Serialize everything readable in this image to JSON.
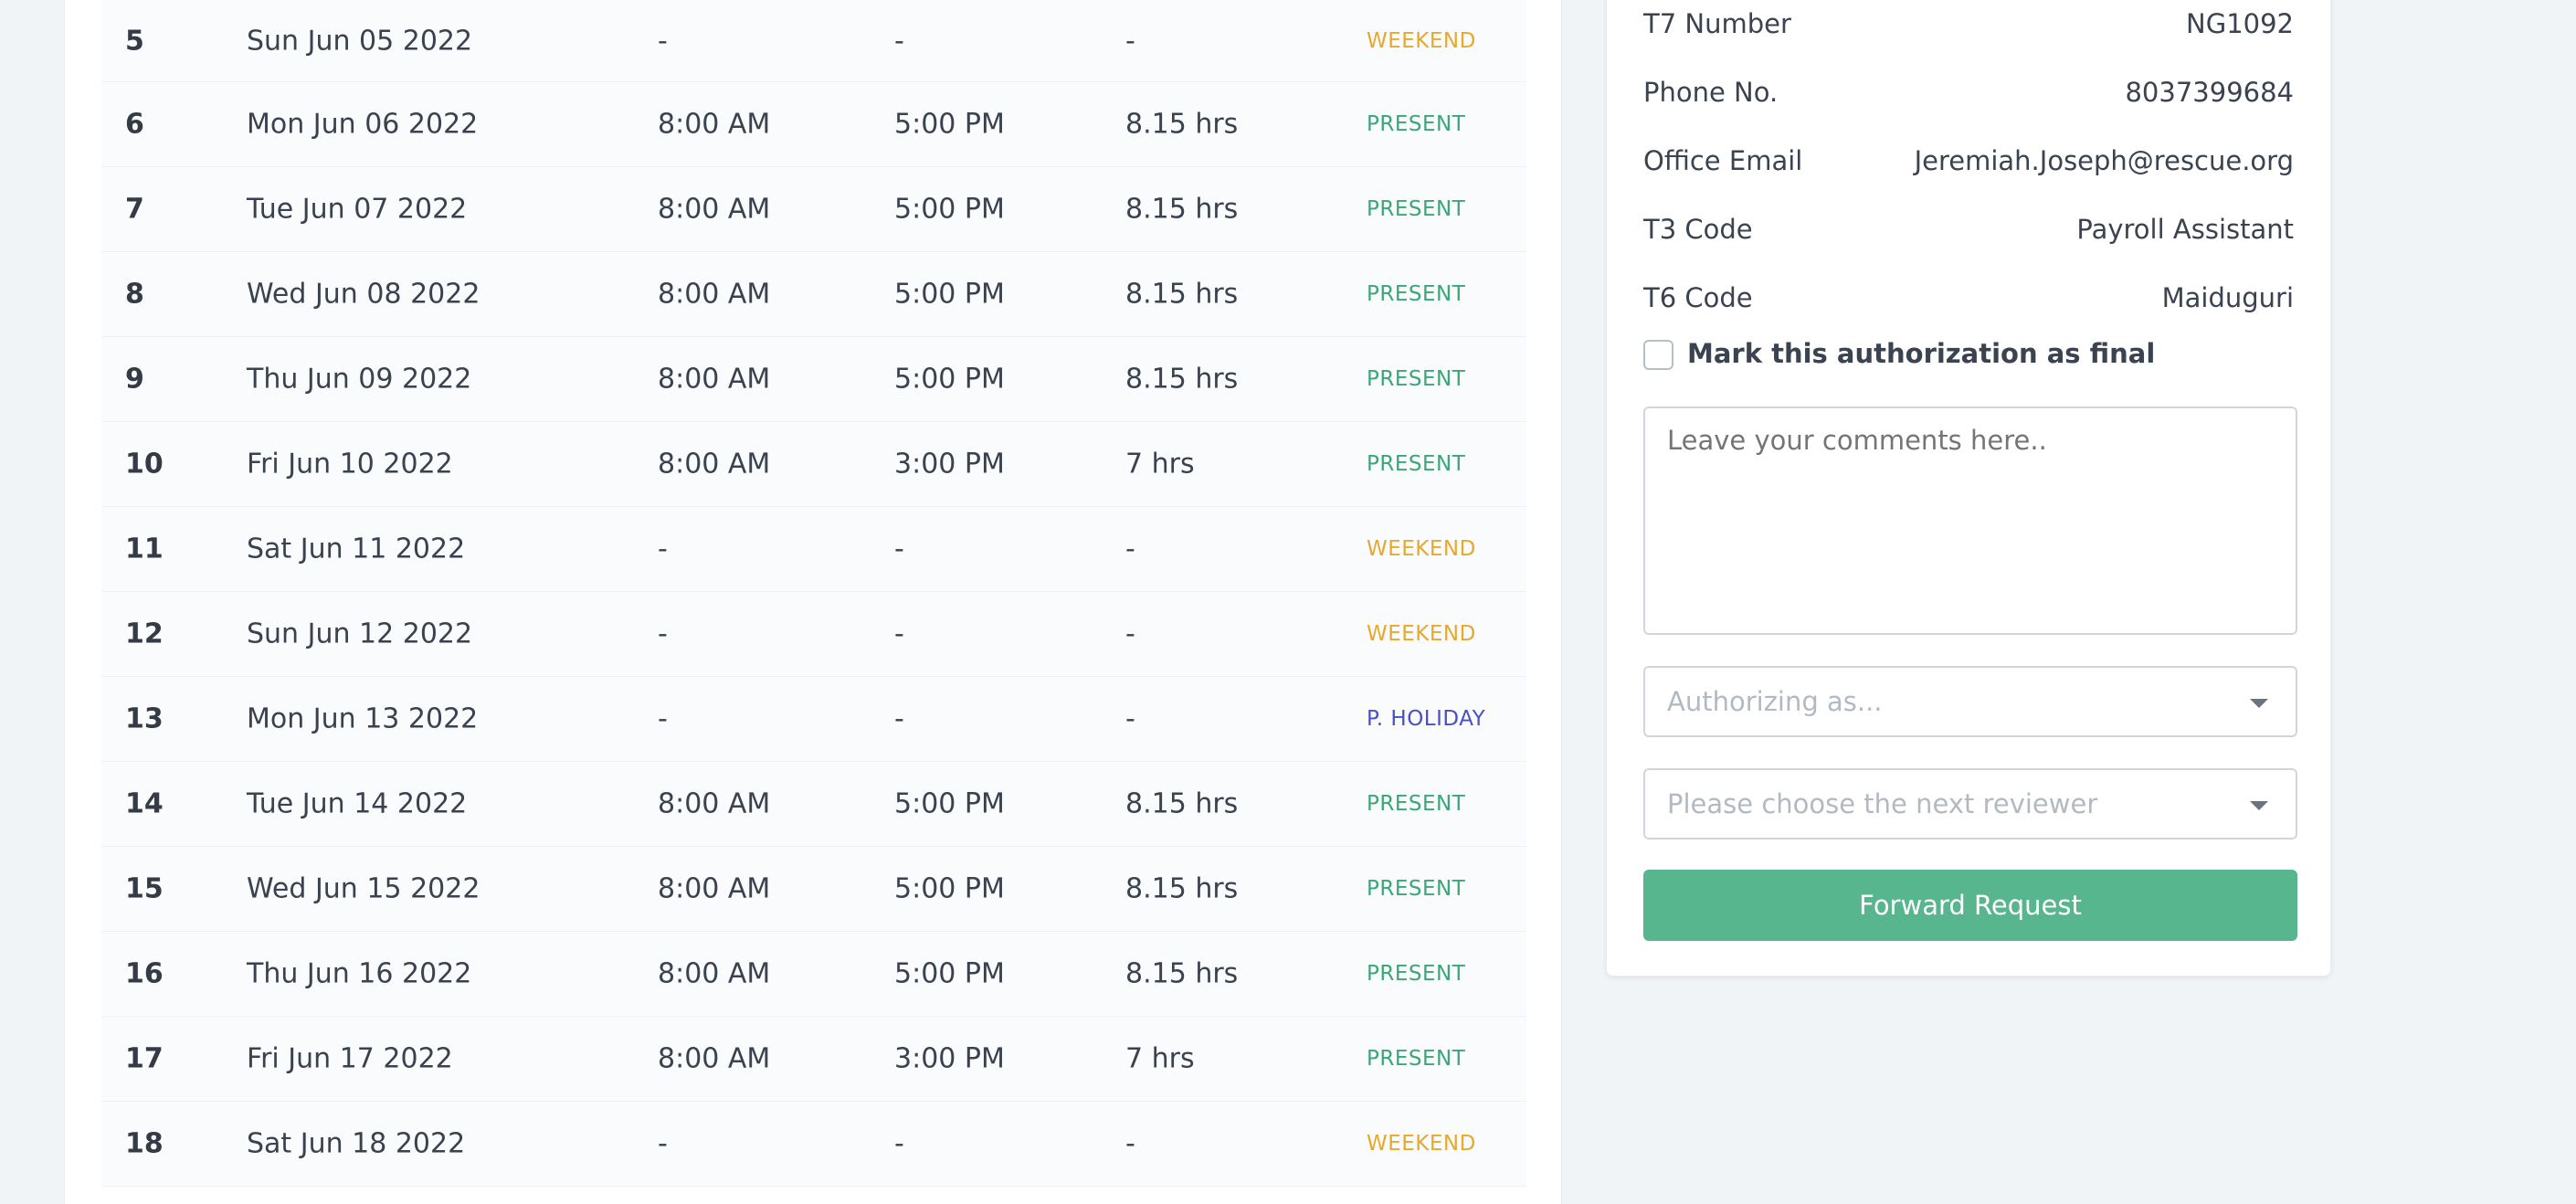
{
  "attendance": {
    "rows": [
      {
        "num": "5",
        "date": "Sun Jun 05 2022",
        "in": "-",
        "out": "-",
        "hours": "-",
        "status": "WEEKEND"
      },
      {
        "num": "6",
        "date": "Mon Jun 06 2022",
        "in": "8:00 AM",
        "out": "5:00 PM",
        "hours": "8.15 hrs",
        "status": "PRESENT"
      },
      {
        "num": "7",
        "date": "Tue Jun 07 2022",
        "in": "8:00 AM",
        "out": "5:00 PM",
        "hours": "8.15 hrs",
        "status": "PRESENT"
      },
      {
        "num": "8",
        "date": "Wed Jun 08 2022",
        "in": "8:00 AM",
        "out": "5:00 PM",
        "hours": "8.15 hrs",
        "status": "PRESENT"
      },
      {
        "num": "9",
        "date": "Thu Jun 09 2022",
        "in": "8:00 AM",
        "out": "5:00 PM",
        "hours": "8.15 hrs",
        "status": "PRESENT"
      },
      {
        "num": "10",
        "date": "Fri Jun 10 2022",
        "in": "8:00 AM",
        "out": "3:00 PM",
        "hours": "7 hrs",
        "status": "PRESENT"
      },
      {
        "num": "11",
        "date": "Sat Jun 11 2022",
        "in": "-",
        "out": "-",
        "hours": "-",
        "status": "WEEKEND"
      },
      {
        "num": "12",
        "date": "Sun Jun 12 2022",
        "in": "-",
        "out": "-",
        "hours": "-",
        "status": "WEEKEND"
      },
      {
        "num": "13",
        "date": "Mon Jun 13 2022",
        "in": "-",
        "out": "-",
        "hours": "-",
        "status": "P. HOLIDAY"
      },
      {
        "num": "14",
        "date": "Tue Jun 14 2022",
        "in": "8:00 AM",
        "out": "5:00 PM",
        "hours": "8.15 hrs",
        "status": "PRESENT"
      },
      {
        "num": "15",
        "date": "Wed Jun 15 2022",
        "in": "8:00 AM",
        "out": "5:00 PM",
        "hours": "8.15 hrs",
        "status": "PRESENT"
      },
      {
        "num": "16",
        "date": "Thu Jun 16 2022",
        "in": "8:00 AM",
        "out": "5:00 PM",
        "hours": "8.15 hrs",
        "status": "PRESENT"
      },
      {
        "num": "17",
        "date": "Fri Jun 17 2022",
        "in": "8:00 AM",
        "out": "3:00 PM",
        "hours": "7 hrs",
        "status": "PRESENT"
      },
      {
        "num": "18",
        "date": "Sat Jun 18 2022",
        "in": "-",
        "out": "-",
        "hours": "-",
        "status": "WEEKEND"
      }
    ],
    "status_colors": {
      "WEEKEND": "#e8a82c",
      "PRESENT": "#3aa776",
      "P. HOLIDAY": "#4a4fc4"
    }
  },
  "details": {
    "items": [
      {
        "label": "T7 Number",
        "value": "NG1092"
      },
      {
        "label": "Phone No.",
        "value": "8037399684"
      },
      {
        "label": "Office Email",
        "value": "Jeremiah.Joseph@rescue.org"
      },
      {
        "label": "T3 Code",
        "value": "Payroll Assistant"
      },
      {
        "label": "T6 Code",
        "value": "Maiduguri"
      }
    ]
  },
  "form": {
    "final_checkbox_label": "Mark this authorization as final",
    "final_checked": false,
    "comments_placeholder": "Leave your comments here..",
    "authorizing_placeholder": "Authorizing as...",
    "reviewer_placeholder": "Please choose the next reviewer",
    "submit_label": "Forward Request",
    "submit_color": "#58b68e"
  }
}
